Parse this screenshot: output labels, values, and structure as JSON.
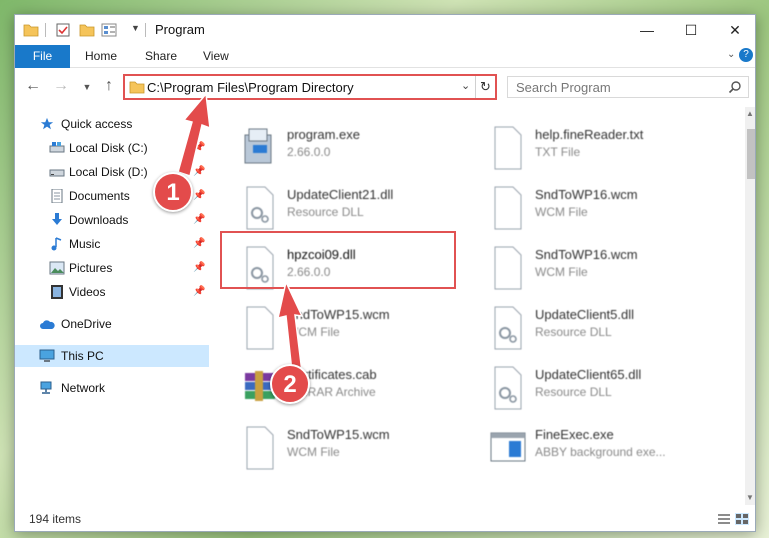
{
  "window": {
    "title": "Program",
    "controls": {
      "minimize": "—",
      "maximize": "☐",
      "close": "✕"
    }
  },
  "ribbon": {
    "tabs": [
      "File",
      "Home",
      "Share",
      "View"
    ],
    "help": "?"
  },
  "address": {
    "path": "C:\\Program Files\\Program Directory",
    "refresh": "↻"
  },
  "search": {
    "placeholder": "Search Program"
  },
  "nav": {
    "items": [
      {
        "label": "Quick access",
        "icon": "star-icon"
      },
      {
        "label": "Local Disk (C:)",
        "icon": "drive-icon",
        "pinned": true
      },
      {
        "label": "Local Disk (D:)",
        "icon": "drive-icon",
        "pinned": true
      },
      {
        "label": "Documents",
        "icon": "document-icon",
        "pinned": true
      },
      {
        "label": "Downloads",
        "icon": "download-icon",
        "pinned": true
      },
      {
        "label": "Music",
        "icon": "music-icon",
        "pinned": true
      },
      {
        "label": "Pictures",
        "icon": "picture-icon",
        "pinned": true
      },
      {
        "label": "Videos",
        "icon": "video-icon",
        "pinned": true
      },
      {
        "label": "OneDrive",
        "icon": "cloud-icon"
      },
      {
        "label": "This PC",
        "icon": "pc-icon",
        "selected": true
      },
      {
        "label": "Network",
        "icon": "network-icon"
      }
    ]
  },
  "files": [
    {
      "name": "program.exe",
      "sub": "2.66.0.0",
      "icon": "installer-icon"
    },
    {
      "name": "help.fineReader.txt",
      "sub": "TXT File",
      "icon": "file-icon"
    },
    {
      "name": "UpdateClient21.dll",
      "sub": "Resource DLL",
      "icon": "dll-icon"
    },
    {
      "name": "SndToWP16.wcm",
      "sub": "WCM File",
      "icon": "file-icon"
    },
    {
      "name": "hpzcoi09.dll",
      "sub": "2.66.0.0",
      "icon": "dll-icon"
    },
    {
      "name": "SndToWP16.wcm",
      "sub": "WCM File",
      "icon": "file-icon"
    },
    {
      "name": "SndToWP15.wcm",
      "sub": "WCM File",
      "icon": "file-icon"
    },
    {
      "name": "UpdateClient5.dll",
      "sub": "Resource DLL",
      "icon": "dll-icon"
    },
    {
      "name": "Certificates.cab",
      "sub": "WinRAR Archive",
      "icon": "archive-icon"
    },
    {
      "name": "UpdateClient65.dll",
      "sub": "Resource DLL",
      "icon": "dll-icon"
    },
    {
      "name": "SndToWP15.wcm",
      "sub": "WCM File",
      "icon": "file-icon"
    },
    {
      "name": "FineExec.exe",
      "sub": "ABBY background exe...",
      "icon": "app-window-icon"
    }
  ],
  "status": {
    "count": "194 items"
  },
  "annotations": {
    "step1": "1",
    "step2": "2"
  },
  "colors": {
    "accent": "#1979ca",
    "highlight": "#e15252",
    "selected": "#cce8ff"
  }
}
